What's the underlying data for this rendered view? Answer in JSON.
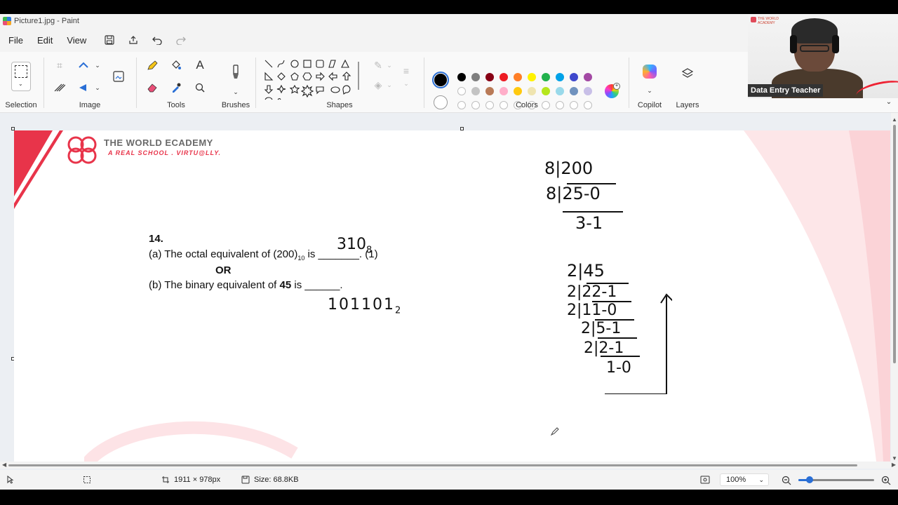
{
  "window": {
    "title": "Picture1.jpg - Paint"
  },
  "menu": {
    "file": "File",
    "edit": "Edit",
    "view": "View"
  },
  "ribbon": {
    "groups": {
      "selection": "Selection",
      "image": "Image",
      "tools": "Tools",
      "brushes": "Brushes",
      "shapes": "Shapes",
      "colors": "Colors",
      "copilot": "Copilot",
      "layers": "Layers"
    },
    "palette_row1": [
      "#000000",
      "#7f7f7f",
      "#880015",
      "#ed1c24",
      "#ff7f27",
      "#fff200",
      "#22b14c",
      "#00a2e8",
      "#3f48cc",
      "#a349a4"
    ],
    "palette_row2": [
      "#ffffff",
      "#c3c3c3",
      "#b97a57",
      "#ffaec9",
      "#ffc90e",
      "#efe4b0",
      "#b5e61d",
      "#99d9ea",
      "#7092be",
      "#c8bfe7"
    ],
    "primary_color": "#000000",
    "secondary_color": "#ffffff"
  },
  "webcam": {
    "name_tag": "Data Entry Teacher",
    "logo_text": "THE WORLD ACADEMY"
  },
  "document": {
    "brand_title": "THE WORLD ECADEMY",
    "brand_sub": "A REAL SCHOOL . VIRTU@LLY.",
    "q_number": "14.",
    "q_a_prefix": "(a) The octal equivalent of (200)",
    "q_a_sub": "10",
    "q_a_suffix": " is _______. (1)",
    "q_or": "OR",
    "q_b": "(b) The binary equivalent of ",
    "q_b_bold": "45",
    "q_b_suffix": " is ______.",
    "ans_a": "310",
    "ans_a_sub": "8",
    "ans_b": "101101",
    "ans_b_sub": "2",
    "octal_work": [
      "8|200",
      "8|25-0",
      "3-1"
    ],
    "binary_work": [
      "2|45",
      "2|22-1",
      "2|11-0",
      "2|5-1",
      "2|2-1",
      "1-0"
    ]
  },
  "status": {
    "dimensions": "1911 × 978px",
    "size": "Size: 68.8KB",
    "zoom": "100%"
  }
}
